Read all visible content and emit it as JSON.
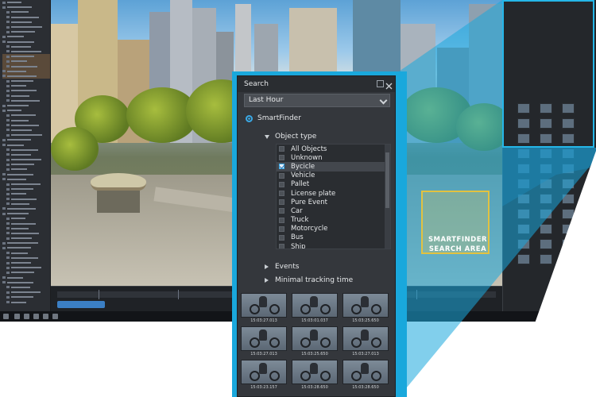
{
  "search_panel": {
    "title": "Search",
    "time_range": "Last Hour",
    "mode_label": "SmartFinder",
    "object_type_label": "Object type",
    "object_types": [
      {
        "label": "All Objects",
        "checked": false
      },
      {
        "label": "Unknown",
        "checked": false
      },
      {
        "label": "Bycicle",
        "checked": true
      },
      {
        "label": "Vehicle",
        "checked": false
      },
      {
        "label": "Pallet",
        "checked": false
      },
      {
        "label": "License plate",
        "checked": false
      },
      {
        "label": "Pure Event",
        "checked": false
      },
      {
        "label": "Car",
        "checked": false
      },
      {
        "label": "Truck",
        "checked": false
      },
      {
        "label": "Motorcycle",
        "checked": false
      },
      {
        "label": "Bus",
        "checked": false
      },
      {
        "label": "Ship",
        "checked": false
      }
    ],
    "events_label": "Events",
    "min_tracking_label": "Minimal tracking time",
    "thumbnails": [
      {
        "caption": "15:03:27.013"
      },
      {
        "caption": "15:03:01.037"
      },
      {
        "caption": "15:03:25.650"
      },
      {
        "caption": "15:03:27.013"
      },
      {
        "caption": "15:03:25.650"
      },
      {
        "caption": "15:03:27.013"
      },
      {
        "caption": "15:03:23.157"
      },
      {
        "caption": "15:03:28.650"
      },
      {
        "caption": "15:03:28.650"
      }
    ]
  },
  "smartfinder_area_label": "SMARTFINDER\nSEARCH AREA",
  "colors": {
    "accent_cyan": "#1aa8dc",
    "area_yellow": "#e2c240",
    "panel_bg": "#34373c"
  }
}
